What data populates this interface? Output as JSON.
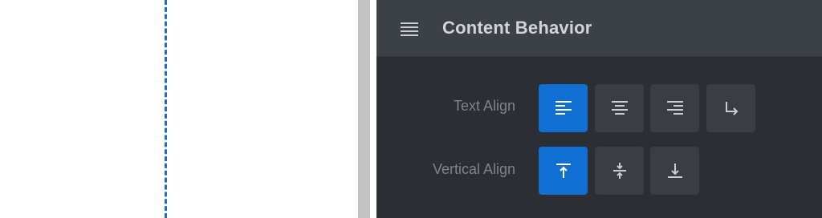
{
  "panel": {
    "title": "Content Behavior",
    "menu_icon": "hamburger-menu-icon"
  },
  "text_align": {
    "label": "Text Align",
    "options": [
      {
        "name": "align-left",
        "icon": "align-left-icon",
        "active": true
      },
      {
        "name": "align-center",
        "icon": "align-center-icon",
        "active": false
      },
      {
        "name": "align-right",
        "icon": "align-right-icon",
        "active": false
      },
      {
        "name": "text-wrap",
        "icon": "arrow-turn-down-right-icon",
        "active": false
      }
    ]
  },
  "vertical_align": {
    "label": "Vertical Align",
    "options": [
      {
        "name": "align-top",
        "icon": "align-top-icon",
        "active": true
      },
      {
        "name": "align-middle",
        "icon": "align-middle-icon",
        "active": false
      },
      {
        "name": "align-bottom",
        "icon": "align-bottom-icon",
        "active": false
      }
    ]
  },
  "colors": {
    "accent": "#0f6fd3",
    "panel_bg": "#2b2e33",
    "header_bg": "#3c4047",
    "button_bg": "#3a3d43",
    "guide_line": "#1f6fc0"
  }
}
